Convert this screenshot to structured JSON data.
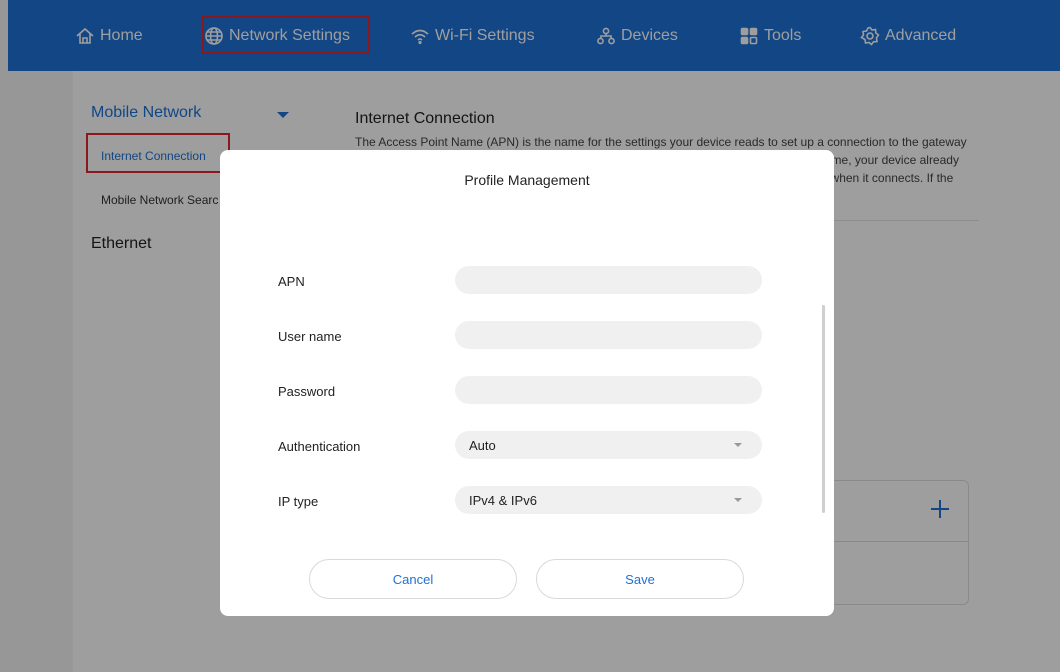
{
  "nav": {
    "items": [
      {
        "label": "Home",
        "icon": "home-icon"
      },
      {
        "label": "Network Settings",
        "icon": "globe-icon",
        "active": true
      },
      {
        "label": "Wi-Fi Settings",
        "icon": "wifi-icon"
      },
      {
        "label": "Devices",
        "icon": "devices-icon"
      },
      {
        "label": "Tools",
        "icon": "tools-icon"
      },
      {
        "label": "Advanced",
        "icon": "gear-icon"
      }
    ]
  },
  "sidebar": {
    "mobile_network": "Mobile Network",
    "internet_connection": "Internet Connection",
    "mobile_network_search": "Mobile Network Search",
    "ethernet": "Ethernet"
  },
  "content": {
    "title": "Internet Connection",
    "description": "The Access Point Name (APN) is the name for the settings your device reads to set up a connection to the gateway between your carrier's mobile network and the public Internet. If you do not set an APN name, your device already has the APN settings of your carrier and will select the correct APN settings automatically when it connects. If the"
  },
  "modal": {
    "title": "Profile Management",
    "fields": {
      "apn_label": "APN",
      "apn_value": "",
      "username_label": "User name",
      "username_value": "",
      "password_label": "Password",
      "password_value": "",
      "auth_label": "Authentication",
      "auth_value": "Auto",
      "iptype_label": "IP type",
      "iptype_value": "IPv4 & IPv6"
    },
    "cancel_label": "Cancel",
    "save_label": "Save"
  },
  "colors": {
    "brand": "#1e71d6",
    "highlight": "#e3262f"
  }
}
